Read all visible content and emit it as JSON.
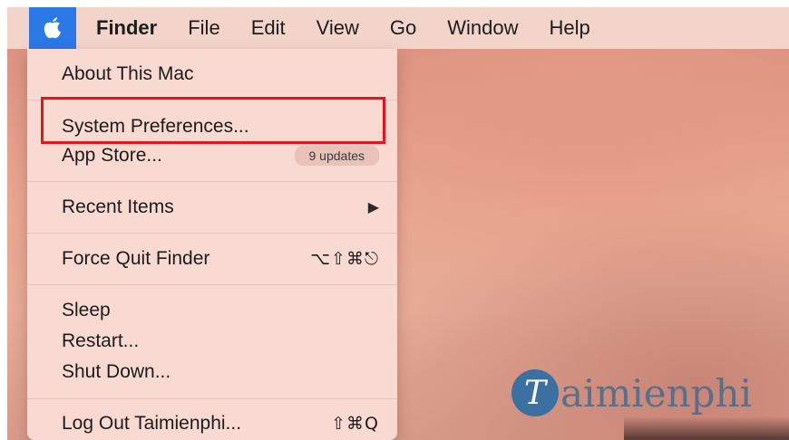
{
  "menubar": {
    "apple_icon": "apple-logo",
    "items": [
      "Finder",
      "File",
      "Edit",
      "View",
      "Go",
      "Window",
      "Help"
    ]
  },
  "apple_menu": {
    "about": "About This Mac",
    "system_preferences": "System Preferences...",
    "app_store": "App Store...",
    "app_store_badge": "9 updates",
    "recent_items": "Recent Items",
    "recent_items_arrow": "▶",
    "force_quit": "Force Quit Finder",
    "force_quit_shortcut": "⌥⇧⌘⎋",
    "sleep": "Sleep",
    "restart": "Restart...",
    "shut_down": "Shut Down...",
    "log_out": "Log Out Taimienphi...",
    "log_out_shortcut": "⇧⌘Q"
  },
  "highlight_color": "#e4161c",
  "accent_color": "#2a79e7",
  "watermark": {
    "letter": "T",
    "text": "aimienphi"
  }
}
